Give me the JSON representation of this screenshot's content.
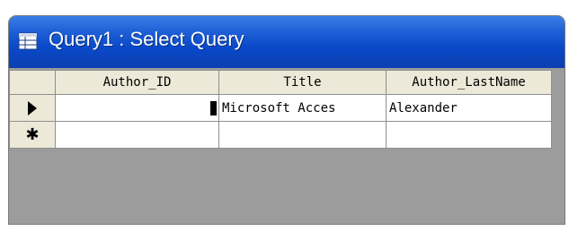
{
  "window": {
    "title": "Query1 : Select Query",
    "icon": "query-icon"
  },
  "datasheet": {
    "columns": [
      "Author_ID",
      "Title",
      "Author_LastName"
    ],
    "rows": [
      {
        "Author_ID": "",
        "Title": "Microsoft Acces",
        "Author_LastName": "Alexander",
        "selector": "current-record-arrow"
      }
    ],
    "new_row_marker": "✱"
  },
  "colors": {
    "titlebar": "#0a49c9",
    "grid_background": "#9c9c9c",
    "header_background": "#ece9d8"
  }
}
